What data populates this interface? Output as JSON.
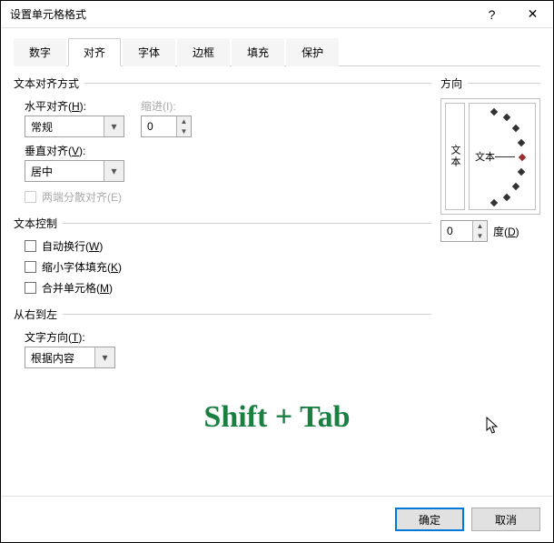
{
  "title": "设置单元格格式",
  "help_icon": "?",
  "close_icon": "✕",
  "tabs": [
    "数字",
    "对齐",
    "字体",
    "边框",
    "填充",
    "保护"
  ],
  "active_tab": 1,
  "groups": {
    "text_align": {
      "title": "文本对齐方式",
      "h_label_pre": "水平对齐(",
      "h_label_u": "H",
      "h_label_post": "):",
      "h_value": "常规",
      "indent_label_pre": "缩进(",
      "indent_label_u": "I",
      "indent_label_post": "):",
      "indent_value": "0",
      "v_label_pre": "垂直对齐(",
      "v_label_u": "V",
      "v_label_post": "):",
      "v_value": "居中",
      "justify_distrib": "两端分散对齐(E)"
    },
    "text_control": {
      "title": "文本控制",
      "wrap_pre": "自动换行(",
      "wrap_u": "W",
      "wrap_post": ")",
      "shrink_pre": "缩小字体填充(",
      "shrink_u": "K",
      "shrink_post": ")",
      "merge_pre": "合并单元格(",
      "merge_u": "M",
      "merge_post": ")"
    },
    "rtl": {
      "title": "从右到左",
      "dir_label_pre": "文字方向(",
      "dir_label_u": "T",
      "dir_label_post": "):",
      "dir_value": "根据内容"
    },
    "orientation": {
      "title": "方向",
      "vert_text": "文本",
      "clock_text": "文本",
      "degree_value": "0",
      "degree_label_pre": "度(",
      "degree_label_u": "D",
      "degree_label_post": ")"
    }
  },
  "overlay_text": "Shift + Tab",
  "buttons": {
    "ok": "确定",
    "cancel": "取消"
  }
}
